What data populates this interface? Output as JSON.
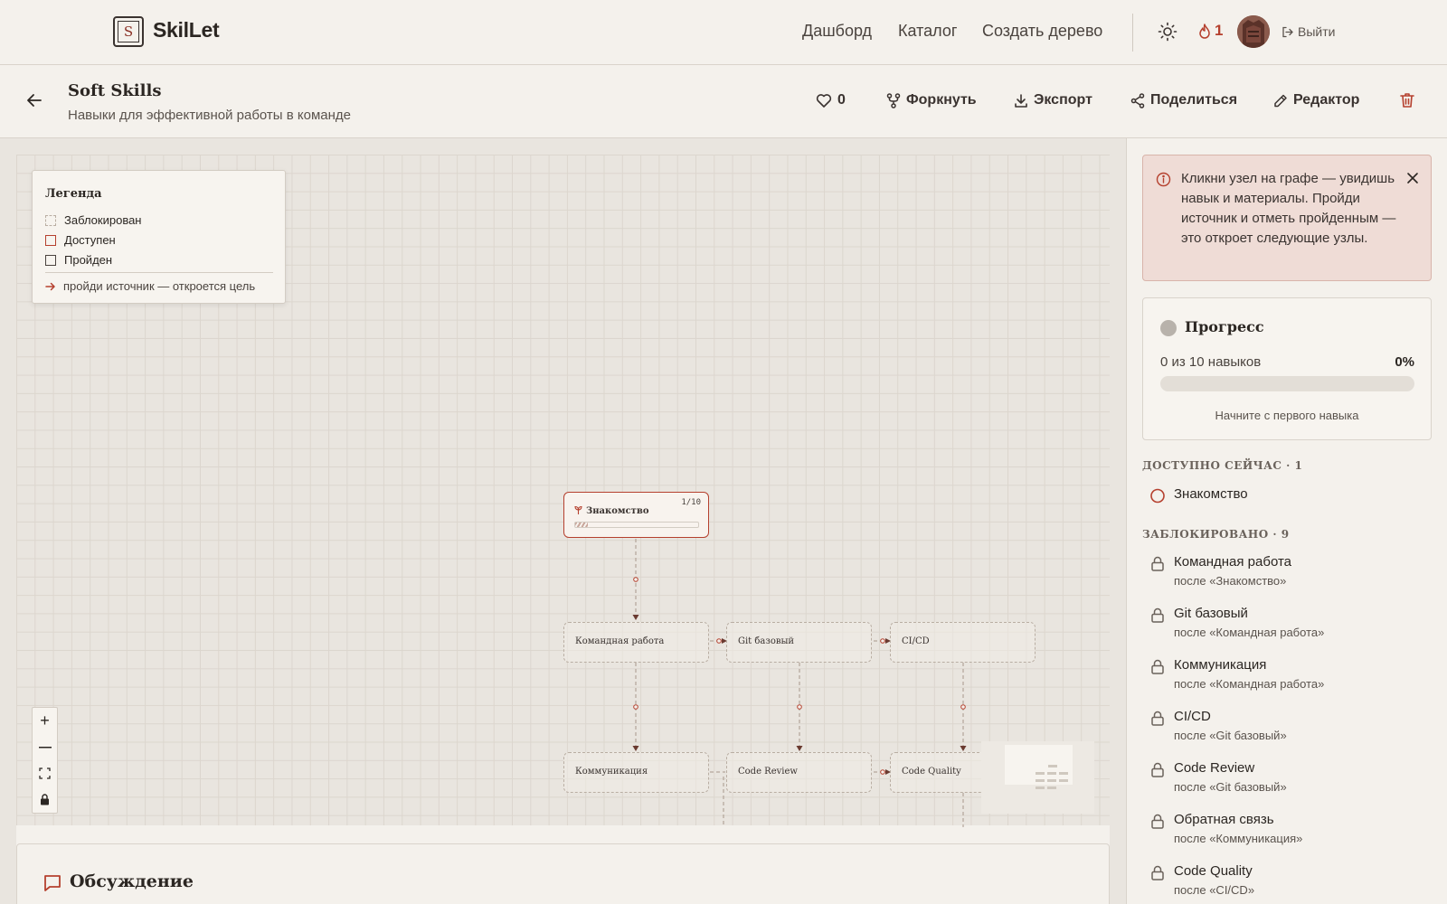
{
  "brand": {
    "logo_letter": "S",
    "name": "SkilLet"
  },
  "nav": {
    "dashboard": "Дашборд",
    "catalog": "Каталог",
    "create": "Создать дерево",
    "streak": "1",
    "logout": "Выйти"
  },
  "tree": {
    "title": "Soft Skills",
    "subtitle": "Навыки для эффективной работы в команде",
    "likes": "0",
    "fork": "Форкнуть",
    "export": "Экспорт",
    "share": "Поделиться",
    "editor": "Редактор"
  },
  "legend": {
    "title": "Легенда",
    "locked": "Заблокирован",
    "available": "Доступен",
    "done": "Пройден",
    "hint": "пройди источник — откроется цель"
  },
  "graph": {
    "nodes": [
      {
        "id": "intro",
        "label": "Знакомство",
        "counter": "1/10"
      },
      {
        "id": "team",
        "label": "Командная работа"
      },
      {
        "id": "git",
        "label": "Git базовый"
      },
      {
        "id": "cicd",
        "label": "CI/CD"
      },
      {
        "id": "comm",
        "label": "Коммуникация"
      },
      {
        "id": "review",
        "label": "Code Review"
      },
      {
        "id": "quality",
        "label": "Code Quality"
      }
    ]
  },
  "discussion": {
    "title": "Обсуждение"
  },
  "sidebar": {
    "hint": "Кликни узел на графе — увидишь навык и материалы. Пройди источник и отметь пройденным — это откроет следующие узлы.",
    "progress": {
      "title": "Прогресс",
      "count": "0 из 10 навыков",
      "percent": "0%",
      "fraction": 0,
      "hint": "Начните с первого навыка"
    },
    "available_head": "ДОСТУПНО СЕЙЧАС · 1",
    "available": [
      {
        "name": "Знакомство"
      }
    ],
    "locked_head": "ЗАБЛОКИРОВАНО · 9",
    "locked": [
      {
        "name": "Командная работа",
        "after": "после «Знакомство»"
      },
      {
        "name": "Git базовый",
        "after": "после «Командная работа»"
      },
      {
        "name": "Коммуникация",
        "after": "после «Командная работа»"
      },
      {
        "name": "CI/CD",
        "after": "после «Git базовый»"
      },
      {
        "name": "Code Review",
        "after": "после «Git базовый»"
      },
      {
        "name": "Обратная связь",
        "after": "после «Коммуникация»"
      },
      {
        "name": "Code Quality",
        "after": "после «CI/CD»"
      }
    ]
  },
  "colors": {
    "accent": "#b5402e",
    "bg": "#f4f1ec"
  }
}
